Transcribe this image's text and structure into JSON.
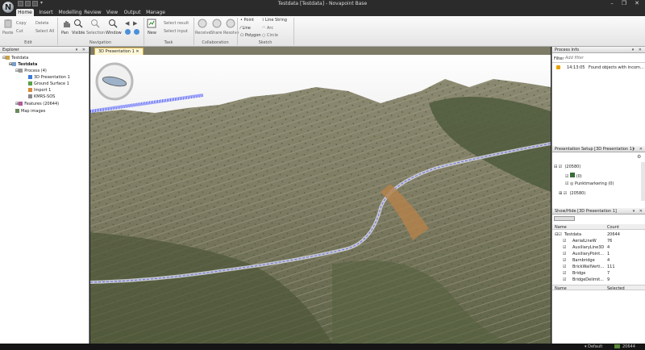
{
  "window": {
    "title": "Testdata [Testdata] - Novapoint Base",
    "logo_letter": "N",
    "controls": [
      "–",
      "❐",
      "✕"
    ]
  },
  "ribbon": {
    "tabs": [
      "Home",
      "Insert",
      "Modelling",
      "Review",
      "View",
      "Output",
      "Manage"
    ],
    "active_tab": "Home",
    "groups": {
      "edit": {
        "label": "Edit",
        "paste": "Paste",
        "copy": "Copy",
        "cut": "Cut",
        "delete": "Delete",
        "select_all": "Select All"
      },
      "navigation": {
        "label": "Navigation",
        "pan": "Pan",
        "visible": "Visible",
        "selection": "Selection",
        "window": "Window"
      },
      "task": {
        "label": "Task",
        "new": "New",
        "select_result": "Select result",
        "select_input": "Select input"
      },
      "collaboration": {
        "label": "Collaboration",
        "receive": "Receive",
        "share": "Share",
        "resolve": "Resolve"
      },
      "sketch": {
        "label": "Sketch",
        "point": "Point",
        "line": "Line",
        "polygon": "Polygon",
        "line_string": "Line String",
        "arc": "Arc",
        "circle": "Circle"
      }
    }
  },
  "explorer": {
    "title": "Explorer",
    "items": [
      {
        "label": "Testdata",
        "level": 0
      },
      {
        "label": "Testdata",
        "level": 1
      },
      {
        "label": "Process (4)",
        "level": 2
      },
      {
        "label": "3D Presentation 1",
        "level": 3
      },
      {
        "label": "Ground Surface 1",
        "level": 3
      },
      {
        "label": "Import 1",
        "level": 3
      },
      {
        "label": "KMRS-SOS",
        "level": 3
      },
      {
        "label": "Features (20644)",
        "level": 2
      },
      {
        "label": "Map images",
        "level": 2
      }
    ]
  },
  "viewport": {
    "tab_label": "3D Presentation 1"
  },
  "process_info": {
    "title": "Process Info",
    "filter_label": "Filter",
    "filter_placeholder": "Add filter",
    "rows": [
      {
        "time": "14:13:05",
        "message": "Found objects with incom..."
      }
    ]
  },
  "presentation_setup": {
    "title": "Presentation Setup [3D Presentation 1]",
    "rows": [
      {
        "label": "(20580)"
      },
      {
        "label": "(0)"
      },
      {
        "label": "Punktmarkering (0)"
      },
      {
        "label": "(20580)"
      }
    ]
  },
  "show_hide": {
    "title": "Show/Hide [3D Presentation 1]",
    "columns": [
      "Name",
      "Count"
    ],
    "rows": [
      {
        "name": "Testdata",
        "count": "20644"
      },
      {
        "name": "AerialLineW",
        "count": "76"
      },
      {
        "name": "AuxiliaryLine3D",
        "count": "4"
      },
      {
        "name": "AuxiliaryPoint...",
        "count": "1"
      },
      {
        "name": "Barnbridge",
        "count": "4"
      },
      {
        "name": "BrickWallVerti...",
        "count": "111"
      },
      {
        "name": "Bridge",
        "count": "7"
      },
      {
        "name": "BridgeDelimit...",
        "count": "9"
      }
    ],
    "footer_columns": [
      "Name",
      "Selected"
    ]
  },
  "statusbar": {
    "profile": "Default",
    "count": "20644"
  },
  "colors": {
    "chrome_dark": "#2b2b2b",
    "ribbon_light": "#f0f0f0",
    "tab_highlight": "#fff7d6",
    "feature_blue": "#2233ff"
  }
}
